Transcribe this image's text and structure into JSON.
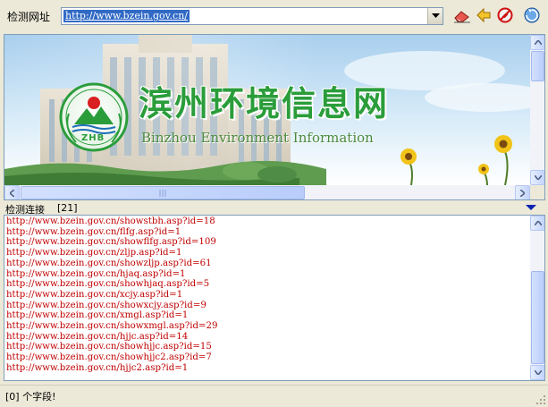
{
  "topbar": {
    "label": "检测网址",
    "url": "http://www.bzein.gov.cn/"
  },
  "banner": {
    "emblem_text": "ZHB",
    "title": "滨州环境信息网",
    "subtitle": "Binzhou Environment Information"
  },
  "links": {
    "title": "检测连接",
    "count": "[21]",
    "items": [
      "http://www.bzein.gov.cn/showstbh.asp?id=18",
      "http://www.bzein.gov.cn/flfg.asp?id=1",
      "http://www.bzein.gov.cn/showflfg.asp?id=109",
      "http://www.bzein.gov.cn/zljp.asp?id=1",
      "http://www.bzein.gov.cn/showzljp.asp?id=61",
      "http://www.bzein.gov.cn/hjaq.asp?id=1",
      "http://www.bzein.gov.cn/showhjaq.asp?id=5",
      "http://www.bzein.gov.cn/xcjy.asp?id=1",
      "http://www.bzein.gov.cn/showxcjy.asp?id=9",
      "http://www.bzein.gov.cn/xmgl.asp?id=1",
      "http://www.bzein.gov.cn/showxmgl.asp?id=29",
      "http://www.bzein.gov.cn/hjjc.asp?id=14",
      "http://www.bzein.gov.cn/showhjjc.asp?id=15",
      "http://www.bzein.gov.cn/showhjjc2.asp?id=7",
      "http://www.bzein.gov.cn/hjjc2.asp?id=1"
    ]
  },
  "status": {
    "text": "[0] 个字段!"
  },
  "colors": {
    "link": "#c00000",
    "selection": "#316ac5",
    "title_green": "#2a9d3a"
  }
}
